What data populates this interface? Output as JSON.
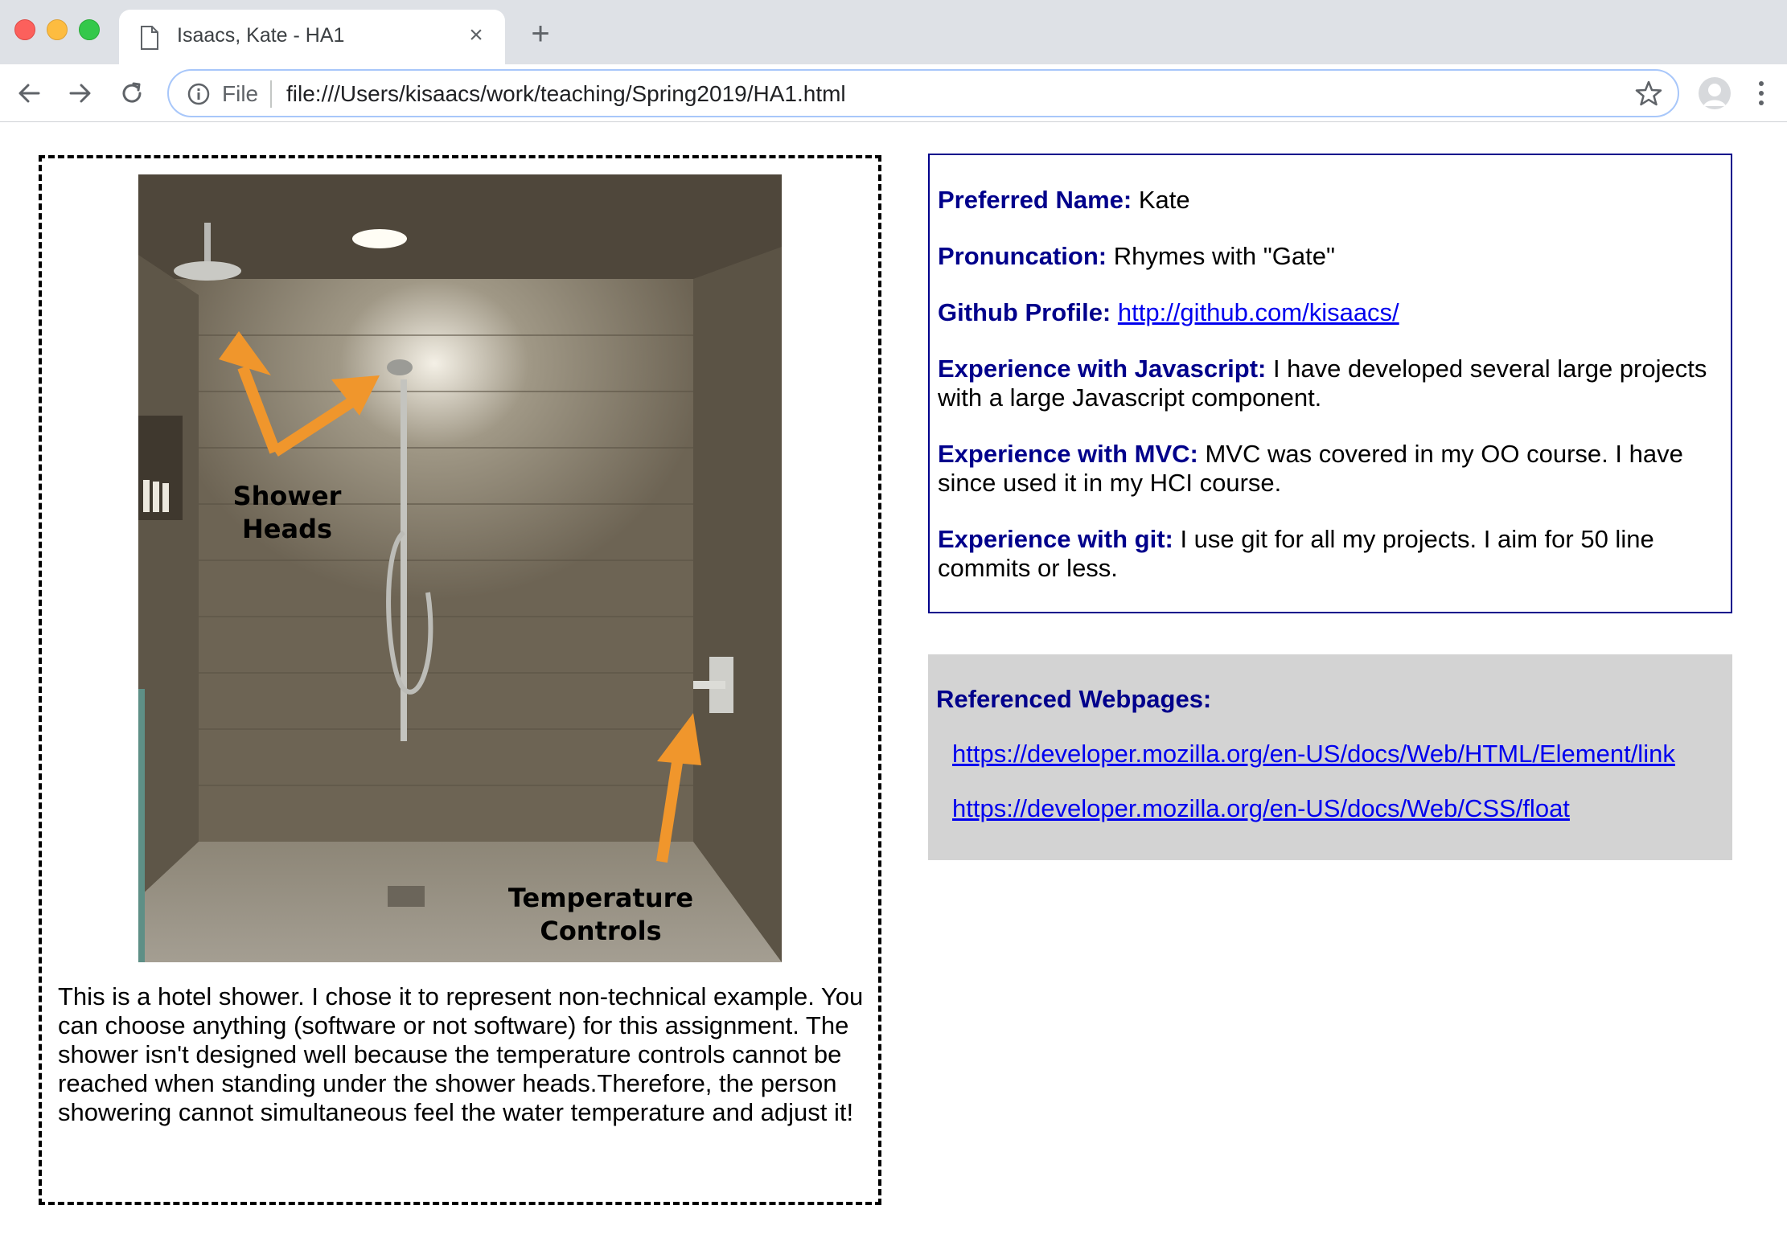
{
  "browser": {
    "tab_title": "Isaacs, Kate - HA1",
    "scheme_label": "File",
    "url": "file:///Users/kisaacs/work/teaching/Spring2019/HA1.html"
  },
  "example": {
    "photo_annotation_1": "Shower\nHeads",
    "photo_annotation_2": "Temperature\nControls",
    "caption": "This is a hotel shower. I chose it to represent non-technical example. You can choose anything (software or not software) for this assignment. The shower isn't designed well because the temperature controls cannot be reached when standing under the shower heads.Therefore, the person showering cannot simultaneous feel the water temperature and adjust it!"
  },
  "profile": {
    "preferred_name_label": "Preferred Name:",
    "preferred_name": " Kate",
    "pronunciation_label": "Pronuncation:",
    "pronunciation": " Rhymes with \"Gate\"",
    "github_label": "Github Profile:",
    "github_url": "http://github.com/kisaacs/",
    "js_label": "Experience with Javascript:",
    "js": " I have developed several large projects with a large Javascript component.",
    "mvc_label": "Experience with MVC:",
    "mvc": " MVC was covered in my OO course. I have since used it in my HCI course.",
    "git_label": "Experience with git:",
    "git": " I use git for all my projects. I aim for 50 line commits or less."
  },
  "references": {
    "title": "Referenced Webpages:",
    "links": [
      "https://developer.mozilla.org/en-US/docs/Web/HTML/Element/link",
      "https://developer.mozilla.org/en-US/docs/Web/CSS/float"
    ]
  },
  "colors": {
    "label_navy": "#00008b",
    "link_blue": "#0000ee",
    "arrow_orange": "#f0962c",
    "refs_bg": "#d3d3d3"
  }
}
